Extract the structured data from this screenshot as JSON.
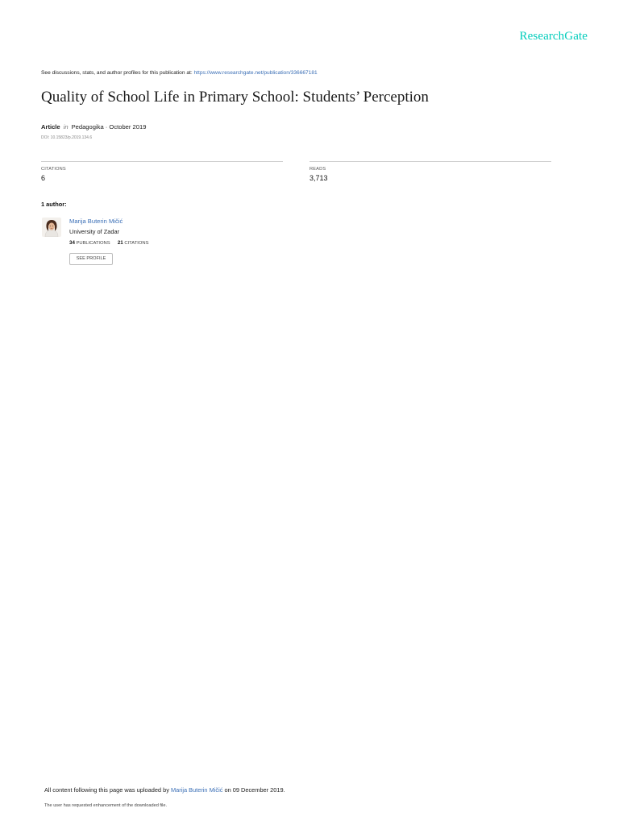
{
  "brand": {
    "logo_text": "ResearchGate",
    "accent_color": "#00ccbb"
  },
  "intro": {
    "text": "See discussions, stats, and author profiles for this publication at: ",
    "link_text": "https://www.researchgate.net/publication/336667181"
  },
  "article": {
    "title": "Quality of School Life in Primary School: Students’ Perception",
    "type": "Article",
    "in_word": "in",
    "venue_date": "Pedagogika · October 2019",
    "doi": "DOI: 10.15823/p.2019.134.6"
  },
  "stats": {
    "citations": {
      "label": "CITATIONS",
      "value": "6"
    },
    "reads": {
      "label": "READS",
      "value": "3,713"
    }
  },
  "authors": {
    "heading": "1 author:",
    "list": [
      {
        "name": "Marija Buterin Mičić",
        "institution": "University of Zadar",
        "publications_count": "34",
        "publications_label": "PUBLICATIONS",
        "citations_count": "21",
        "citations_label": "CITATIONS",
        "profile_button": "SEE PROFILE"
      }
    ]
  },
  "footer": {
    "upload_prefix": "All content following this page was uploaded by ",
    "uploader": "Marija Buterin Mičić",
    "upload_suffix": " on 09 December 2019.",
    "enhancement_note": "The user has requested enhancement of the downloaded file."
  },
  "colors": {
    "link": "#3b6fb6",
    "rule": "#cfcfcf"
  }
}
